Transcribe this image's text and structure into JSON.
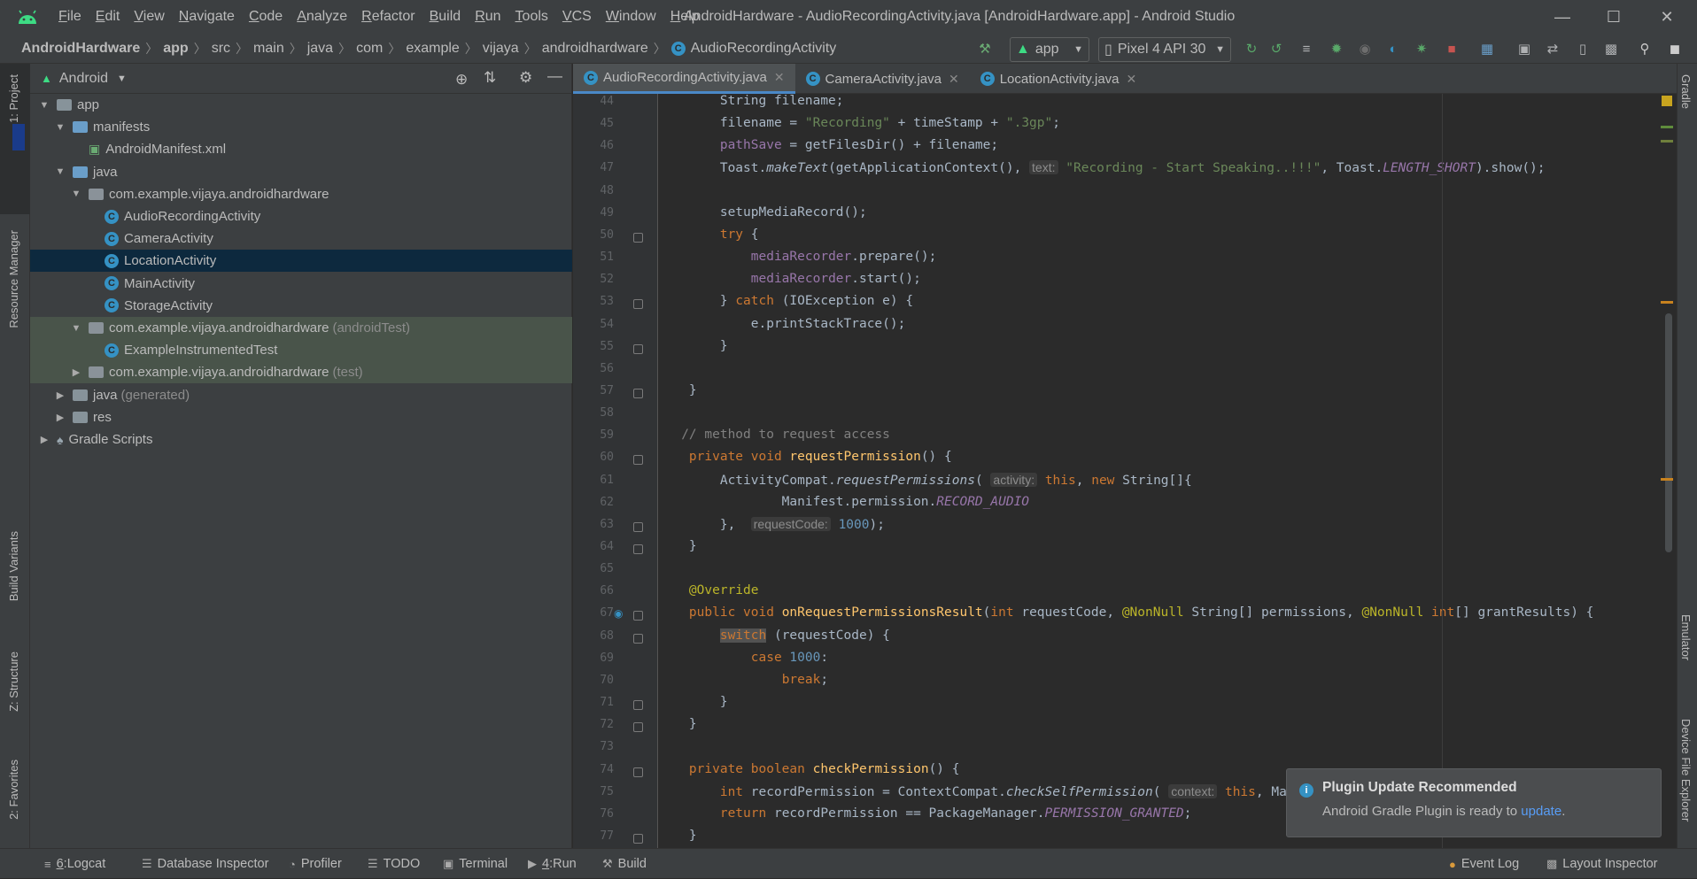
{
  "window": {
    "title": "AndroidHardware - AudioRecordingActivity.java [AndroidHardware.app] - Android Studio",
    "menus": [
      "File",
      "Edit",
      "View",
      "Navigate",
      "Code",
      "Analyze",
      "Refactor",
      "Build",
      "Run",
      "Tools",
      "VCS",
      "Window",
      "Help"
    ]
  },
  "navbar": {
    "breadcrumbs": [
      "AndroidHardware",
      "app",
      "src",
      "main",
      "java",
      "com",
      "example",
      "vijaya",
      "androidhardware",
      "AudioRecordingActivity"
    ],
    "run_config": "app",
    "device": "Pixel 4 API 30"
  },
  "left_tools": [
    "1: Project",
    "Resource Manager",
    "Build Variants",
    "Z: Structure",
    "2: Favorites"
  ],
  "right_tools": [
    "Gradle",
    "Emulator",
    "Device File Explorer"
  ],
  "project": {
    "view_label": "Android",
    "tree": [
      {
        "label": "app",
        "suffix": "",
        "depth": 0,
        "arrow": "▼",
        "icon": "folder"
      },
      {
        "label": "manifests",
        "suffix": "",
        "depth": 1,
        "arrow": "▼",
        "icon": "folder-blue"
      },
      {
        "label": "AndroidManifest.xml",
        "suffix": "",
        "depth": 2,
        "arrow": "",
        "icon": "xml"
      },
      {
        "label": "java",
        "suffix": "",
        "depth": 1,
        "arrow": "▼",
        "icon": "folder-blue"
      },
      {
        "label": "com.example.vijaya.androidhardware",
        "suffix": "",
        "depth": 2,
        "arrow": "▼",
        "icon": "package"
      },
      {
        "label": "AudioRecordingActivity",
        "suffix": "",
        "depth": 3,
        "arrow": "",
        "icon": "class"
      },
      {
        "label": "CameraActivity",
        "suffix": "",
        "depth": 3,
        "arrow": "",
        "icon": "class"
      },
      {
        "label": "LocationActivity",
        "suffix": "",
        "depth": 3,
        "arrow": "",
        "icon": "class",
        "selected": true
      },
      {
        "label": "MainActivity",
        "suffix": "",
        "depth": 3,
        "arrow": "",
        "icon": "class"
      },
      {
        "label": "StorageActivity",
        "suffix": "",
        "depth": 3,
        "arrow": "",
        "icon": "class"
      },
      {
        "label": "com.example.vijaya.androidhardware",
        "suffix": "(androidTest)",
        "depth": 2,
        "arrow": "▼",
        "icon": "package",
        "test": true
      },
      {
        "label": "ExampleInstrumentedTest",
        "suffix": "",
        "depth": 3,
        "arrow": "",
        "icon": "class",
        "test": true
      },
      {
        "label": "com.example.vijaya.androidhardware",
        "suffix": "(test)",
        "depth": 2,
        "arrow": "▶",
        "icon": "package",
        "test": true
      },
      {
        "label": "java",
        "suffix": "(generated)",
        "depth": 1,
        "arrow": "▶",
        "icon": "folder"
      },
      {
        "label": "res",
        "suffix": "",
        "depth": 1,
        "arrow": "▶",
        "icon": "folder"
      },
      {
        "label": "Gradle Scripts",
        "suffix": "",
        "depth": 0,
        "arrow": "▶",
        "icon": "gradle"
      }
    ]
  },
  "editor": {
    "tabs": [
      "AudioRecordingActivity.java",
      "CameraActivity.java",
      "LocationActivity.java"
    ],
    "active_tab": 0,
    "lines": [
      {
        "n": 44,
        "html": "        String filename;"
      },
      {
        "n": 45,
        "html": "        filename = <span class=\"str\">\"Recording\"</span> + timeStamp + <span class=\"str\">\".3gp\"</span>;"
      },
      {
        "n": 46,
        "html": "        <span class=\"fld\">pathSave</span> = getFilesDir() + filename;"
      },
      {
        "n": 47,
        "html": "        Toast.<span class=\"it\">makeText</span>(getApplicationContext(), <span class=\"hint\">text:</span> <span class=\"str\">\"Recording - Start Speaking..!!!\"</span>, Toast.<span class=\"fldi\">LENGTH_SHORT</span>).show();"
      },
      {
        "n": 48,
        "html": ""
      },
      {
        "n": 49,
        "html": "        setupMediaRecord();"
      },
      {
        "n": 50,
        "html": "        <span class=\"kw\">try</span> {"
      },
      {
        "n": 51,
        "html": "            <span class=\"fld\">mediaRecorder</span>.prepare();"
      },
      {
        "n": 52,
        "html": "            <span class=\"fld\">mediaRecorder</span>.start();"
      },
      {
        "n": 53,
        "html": "        } <span class=\"kw\">catch</span> (IOException e) {"
      },
      {
        "n": 54,
        "html": "            e.printStackTrace();"
      },
      {
        "n": 55,
        "html": "        }"
      },
      {
        "n": 56,
        "html": ""
      },
      {
        "n": 57,
        "html": "    }"
      },
      {
        "n": 58,
        "html": ""
      },
      {
        "n": 59,
        "html": "   <span class=\"cmt\">// method to request access</span>"
      },
      {
        "n": 60,
        "html": "    <span class=\"kw\">private void</span> <span class=\"fn\">requestPermission</span>() {"
      },
      {
        "n": 61,
        "html": "        ActivityCompat.<span class=\"it\">requestPermissions</span>( <span class=\"hint\">activity:</span> <span class=\"kw\">this</span>, <span class=\"kw\">new</span> String[]{"
      },
      {
        "n": 62,
        "html": "                Manifest.permission.<span class=\"fldi\">RECORD_AUDIO</span>"
      },
      {
        "n": 63,
        "html": "        },  <span class=\"hint\">requestCode:</span> <span class=\"num\">1000</span>);"
      },
      {
        "n": 64,
        "html": "    }"
      },
      {
        "n": 65,
        "html": ""
      },
      {
        "n": 66,
        "html": "    <span class=\"ann\">@Override</span>"
      },
      {
        "n": 67,
        "html": "    <span class=\"kw\">public void</span> <span class=\"fn\">onRequestPermissionsResult</span>(<span class=\"kw\">int</span> requestCode, <span class=\"ann\">@NonNull</span> String[] permissions, <span class=\"ann\">@NonNull</span> <span class=\"kw\">int</span>[] grantResults) {"
      },
      {
        "n": 68,
        "html": "        <span class=\"kw hl\">switch</span> (requestCode) {"
      },
      {
        "n": 69,
        "html": "            <span class=\"kw\">case</span> <span class=\"num\">1000</span>:"
      },
      {
        "n": 70,
        "html": "                <span class=\"kw\">break</span>;"
      },
      {
        "n": 71,
        "html": "        }"
      },
      {
        "n": 72,
        "html": "    }"
      },
      {
        "n": 73,
        "html": ""
      },
      {
        "n": 74,
        "html": "    <span class=\"kw\">private boolean</span> <span class=\"fn\">checkPermission</span>() {"
      },
      {
        "n": 75,
        "html": "        <span class=\"kw\">int</span> recordPermission = ContextCompat.<span class=\"it\">checkSelfPermission</span>( <span class=\"hint\">context:</span> <span class=\"kw\">this</span>, Ma"
      },
      {
        "n": 76,
        "html": "        <span class=\"kw\">return</span> recordPermission == PackageManager.<span class=\"fldi\">PERMISSION_GRANTED</span>;"
      },
      {
        "n": 77,
        "html": "    }"
      }
    ],
    "fold_lines": [
      50,
      53,
      55,
      57,
      60,
      63,
      64,
      67,
      68,
      71,
      72,
      74,
      77
    ]
  },
  "bottom_tabs": {
    "left": [
      {
        "id": "logcat",
        "num": "6",
        "label": "Logcat"
      },
      {
        "id": "database-inspector",
        "num": "",
        "label": "Database Inspector"
      },
      {
        "id": "profiler",
        "num": "",
        "label": "Profiler"
      },
      {
        "id": "todo",
        "num": "",
        "label": "TODO"
      },
      {
        "id": "terminal",
        "num": "",
        "label": "Terminal"
      },
      {
        "id": "run",
        "num": "4",
        "label": "Run"
      },
      {
        "id": "build",
        "num": "",
        "label": "Build"
      }
    ],
    "right": [
      {
        "id": "event-log",
        "label": "Event Log"
      },
      {
        "id": "layout-inspector",
        "label": "Layout Inspector"
      }
    ]
  },
  "notification": {
    "title": "Plugin Update Recommended",
    "body": "Android Gradle Plugin is ready to ",
    "link": "update",
    "tail": "."
  },
  "colors": {
    "accent": "#4a88c7",
    "android_green": "#3ddc84",
    "stop_red": "#c75450"
  }
}
